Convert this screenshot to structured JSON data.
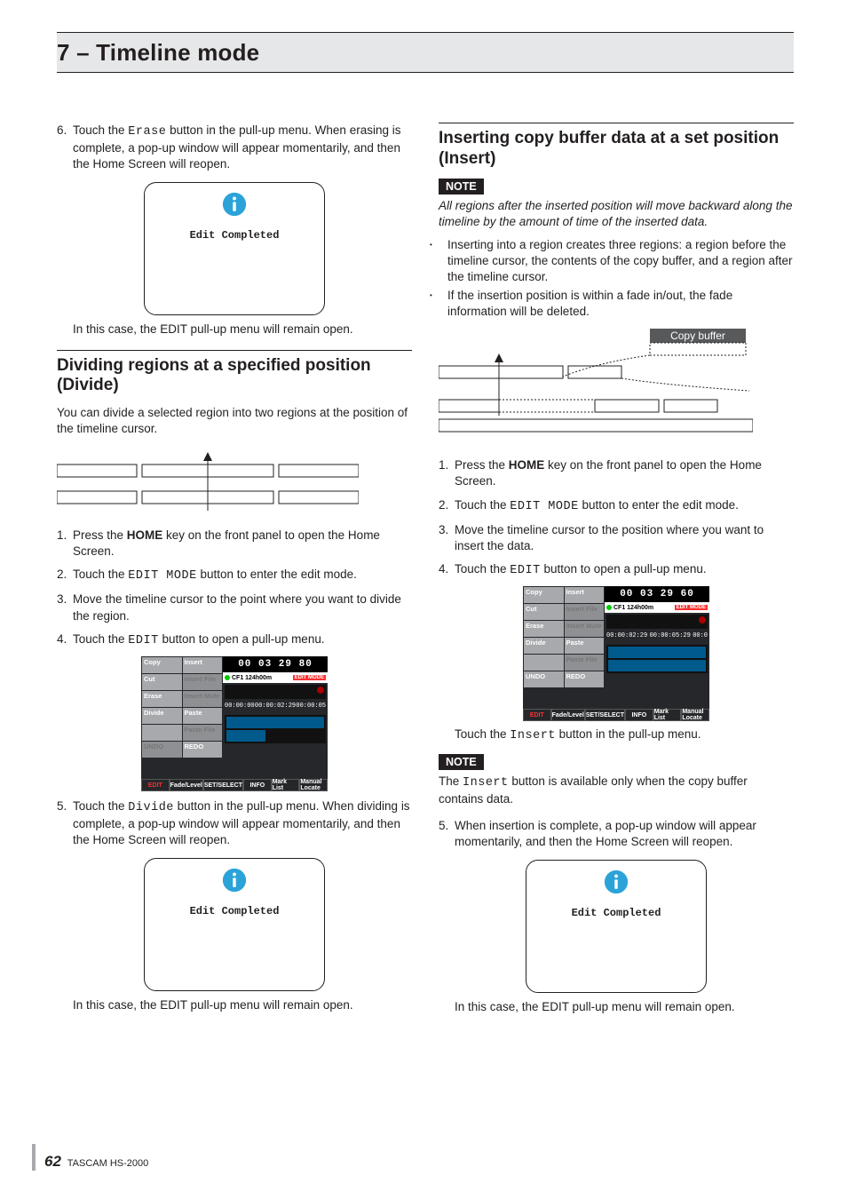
{
  "chapter_title": "7 – Timeline mode",
  "left": {
    "step6": "Touch the Erase button in the pull-up menu. When erasing is complete, a pop-up window will appear momentarily, and then the Home Screen will reopen.",
    "popup1_text": "Edit Completed",
    "popup1_caption": "In this case, the EDIT pull-up menu will remain open.",
    "divide_title": "Dividing regions at a specified position (Divide)",
    "divide_intro": "You can divide a selected region into two regions at the position of the timeline cursor.",
    "d_steps": [
      "Press the HOME key on the front panel to open the Home Screen.",
      "Touch the EDIT MODE button to enter the edit mode.",
      "Move the timeline cursor to the point where you want to divide the region.",
      "Touch the EDIT button to open a pull-up menu."
    ],
    "d_step5": "Touch the Divide button in the pull-up menu. When dividing is complete, a pop-up window will appear momentarily, and then the Home Screen will reopen.",
    "popup2_text": "Edit Completed",
    "popup2_caption": "In this case, the EDIT pull-up menu will remain open."
  },
  "right": {
    "insert_title": "Inserting copy buffer data at a set position (Insert)",
    "note_label": "NOTE",
    "note1_text": "All regions after the inserted position will move backward along the timeline by the amount of time of the inserted data.",
    "bullets": [
      "Inserting into a region creates three regions: a region before the timeline cursor, the contents of the copy buffer, and a region after the timeline cursor.",
      "If the insertion position is within a fade in/out, the fade information will be deleted."
    ],
    "copy_buffer_label": "Copy buffer",
    "i_steps": [
      "Press the HOME key on the front panel to open the Home Screen.",
      "Touch the EDIT MODE button to enter the edit mode.",
      "Move the timeline cursor to the position where you want to insert the data.",
      "Touch the EDIT button to open a pull-up menu."
    ],
    "touch_insert_caption": "Touch the Insert button in the pull-up menu.",
    "note2_text": "The Insert button is available only when the copy buffer contains data.",
    "i_step5": "When insertion is complete, a pop-up window will appear momentarily, and then the Home Screen will reopen.",
    "popup3_text": "Edit Completed",
    "popup3_caption": "In this case, the EDIT pull-up menu will remain open."
  },
  "screenshot": {
    "menu_items": [
      "Copy",
      "Insert",
      "Cut",
      "Insert File",
      "Erase",
      "Insert Mute",
      "Divide",
      "Paste",
      "",
      "Paste File",
      "UNDO",
      "REDO"
    ],
    "bottom_items": [
      "EDIT",
      "Fade/Level",
      "SET/SELECT",
      "INFO",
      "Mark List",
      "Manual Locate"
    ],
    "tc_left": "00 03 29 80",
    "cf_label": "CF1 124h00m",
    "edit_mode_label": "EDIT MODE"
  },
  "footer": {
    "page": "62",
    "product": "TASCAM HS-2000"
  }
}
